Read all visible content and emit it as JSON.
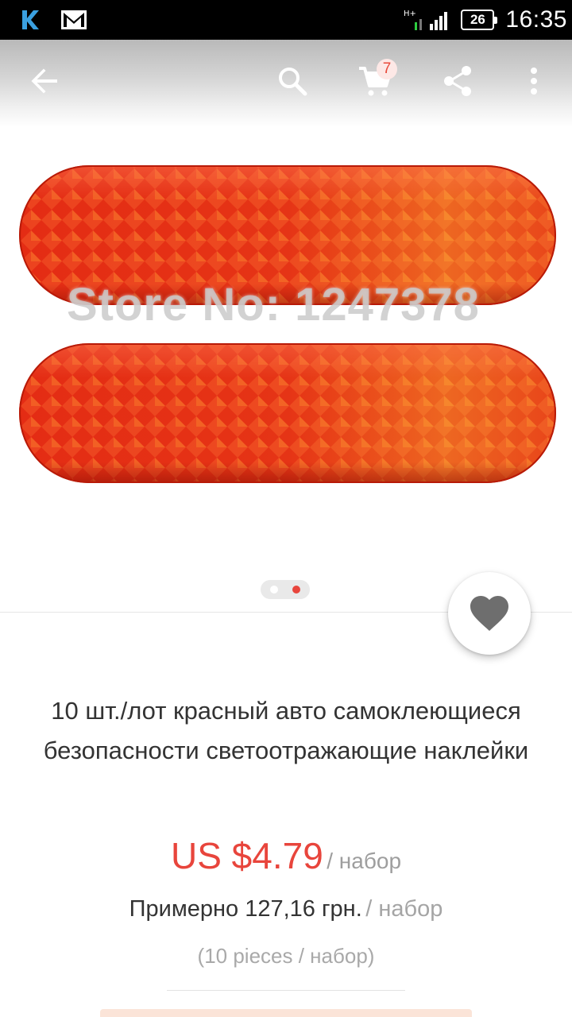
{
  "status_bar": {
    "time": "16:35",
    "battery": "26",
    "network": "H+",
    "icons": [
      "k-app-icon",
      "gmail-icon",
      "signal-icon",
      "battery-icon"
    ]
  },
  "toolbar": {
    "cart_count": "7",
    "icons": [
      "back-arrow-icon",
      "search-icon",
      "cart-icon",
      "share-icon",
      "more-vert-icon"
    ]
  },
  "product_image": {
    "watermark": "Store No: 1247378",
    "slides": 2,
    "active_slide": 2
  },
  "product": {
    "title": "10 шт./лот красный авто самоклеющиеся безопасности светоотражающие наклейки",
    "price": "US $4.79",
    "price_unit": "/ набор",
    "approx": "Примерно 127,16 грн.",
    "approx_unit": "/ набор",
    "pieces": "(10 pieces / набор)"
  },
  "colors": {
    "accent": "#e8453c",
    "reflector_red": "#e8301c",
    "muted_text": "#9e9e9e"
  }
}
